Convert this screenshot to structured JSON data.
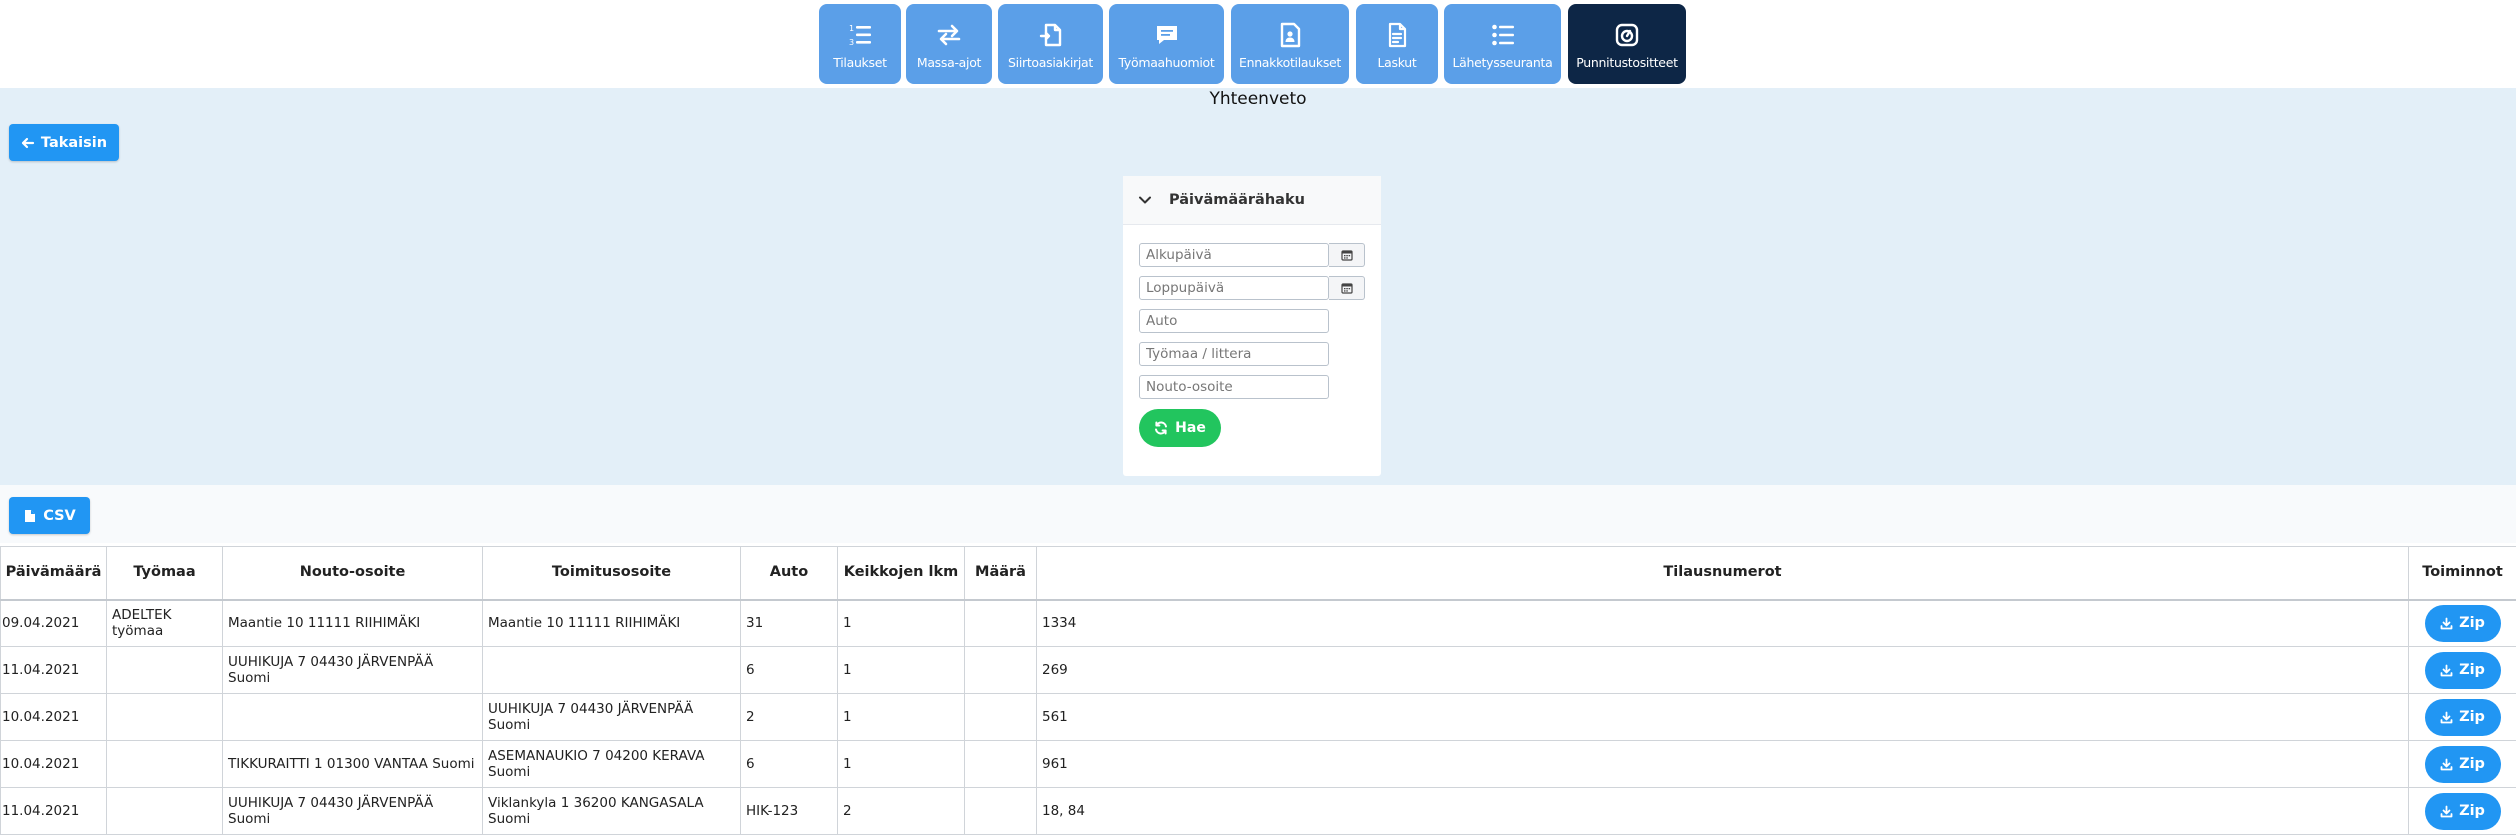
{
  "nav": {
    "items": [
      {
        "label": "Tilaukset",
        "icon": "numbered-list-icon"
      },
      {
        "label": "Massa-ajot",
        "icon": "exchange-arrows-icon"
      },
      {
        "label": "Siirtoasiakirjat",
        "icon": "document-transfer-icon"
      },
      {
        "label": "Työmaahuomiot",
        "icon": "comment-icon"
      },
      {
        "label": "Ennakkotilaukset",
        "icon": "contact-card-icon"
      },
      {
        "label": "Laskut",
        "icon": "invoice-icon"
      },
      {
        "label": "Lähetysseuranta",
        "icon": "checklist-icon"
      },
      {
        "label": "Punnitustositteet",
        "icon": "scale-icon"
      }
    ],
    "active": "Punnitustositteet",
    "colors": {
      "button": "#5b9fe8",
      "active": "#0d2646"
    }
  },
  "page": {
    "title": "Yhteenveto"
  },
  "back_button": {
    "label": "Takaisin"
  },
  "search": {
    "header": "Päivämäärähaku",
    "start_date_placeholder": "Alkupäivä",
    "end_date_placeholder": "Loppupäivä",
    "auto_placeholder": "Auto",
    "site_placeholder": "Työmaa / littera",
    "pickup_placeholder": "Nouto-osoite",
    "submit_label": "Hae"
  },
  "csv_button": {
    "label": "CSV"
  },
  "table": {
    "headers": {
      "date": "Päivämäärä",
      "site": "Työmaa",
      "pickup": "Nouto-osoite",
      "delivery": "Toimitusosoite",
      "auto": "Auto",
      "trips": "Keikkojen lkm",
      "amount": "Määrä",
      "orders": "Tilausnumerot",
      "actions": "Toiminnot"
    },
    "action_label": "Zip",
    "rows": [
      {
        "date": "09.04.2021",
        "site": "ADELTEK työmaa",
        "pickup": "Maantie 10 11111 RIIHIMÄKI",
        "delivery": "Maantie 10 11111 RIIHIMÄKI",
        "auto": "31",
        "trips": "1",
        "amount": "",
        "orders": "1334"
      },
      {
        "date": "11.04.2021",
        "site": "",
        "pickup": "UUHIKUJA 7 04430 JÄRVENPÄÄ Suomi",
        "delivery": "",
        "auto": "6",
        "trips": "1",
        "amount": "",
        "orders": "269"
      },
      {
        "date": "10.04.2021",
        "site": "",
        "pickup": "",
        "delivery": "UUHIKUJA 7 04430 JÄRVENPÄÄ Suomi",
        "auto": "2",
        "trips": "1",
        "amount": "",
        "orders": "561"
      },
      {
        "date": "10.04.2021",
        "site": "",
        "pickup": "TIKKURAITTI 1 01300 VANTAA Suomi",
        "delivery": "ASEMANAUKIO 7 04200 KERAVA Suomi",
        "auto": "6",
        "trips": "1",
        "amount": "",
        "orders": "961"
      },
      {
        "date": "11.04.2021",
        "site": "",
        "pickup": "UUHIKUJA 7 04430 JÄRVENPÄÄ Suomi",
        "delivery": "Viklankyla 1 36200 KANGASALA Suomi",
        "auto": "HIK-123",
        "trips": "2",
        "amount": "",
        "orders": "18, 84"
      }
    ]
  }
}
